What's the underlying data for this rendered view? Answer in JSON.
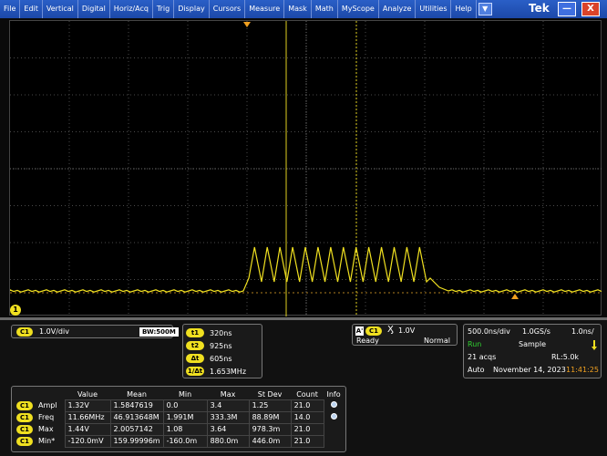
{
  "menu": {
    "items": [
      "File",
      "Edit",
      "Vertical",
      "Digital",
      "Horiz/Acq",
      "Trig",
      "Display",
      "Cursors",
      "Measure",
      "Mask",
      "Math",
      "MyScope",
      "Analyze",
      "Utilities",
      "Help"
    ],
    "dropdown_symbol": "▼",
    "brand": "Tek",
    "minimize_symbol": "—",
    "close_symbol": "X"
  },
  "scope": {
    "channel_marker": "1",
    "trace_color": "#f0e020",
    "pulse_count": 14
  },
  "channel": {
    "badge": "C1",
    "scale": "1.0V/div",
    "bandwidth": "BW:500M"
  },
  "cursors": [
    {
      "label": "t1",
      "value": "320ns"
    },
    {
      "label": "t2",
      "value": "925ns"
    },
    {
      "label": "Δt",
      "value": "605ns"
    },
    {
      "label": "1/Δt",
      "value": "1.653MHz"
    }
  ],
  "trigger": {
    "source_letter": "A'",
    "channel": "C1",
    "edge_symbol": "Ӽ",
    "level": "1.0V",
    "status": "Ready",
    "mode": "Normal"
  },
  "acquisition": {
    "timebase": "500.0ns/div",
    "sample_rate": "1.0GS/s",
    "resolution": "1.0ns/",
    "state": "Run",
    "acq_mode": "Sample",
    "acqs": "21 acqs",
    "record_length": "RL:5.0k",
    "trigger_mode": "Auto",
    "date": "November 14, 2023",
    "time": "11:41:25"
  },
  "measurements": {
    "headers": [
      "",
      "",
      "Value",
      "Mean",
      "Min",
      "Max",
      "St Dev",
      "Count",
      "Info"
    ],
    "rows": [
      {
        "channel": "C1",
        "name": "Ampl",
        "value": "1.32V",
        "mean": "1.5847619",
        "min": "0.0",
        "max": "3.4",
        "stdev": "1.25",
        "count": "21.0",
        "info": true
      },
      {
        "channel": "C1",
        "name": "Freq",
        "value": "11.66MHz",
        "mean": "46.913648M",
        "min": "1.991M",
        "max": "333.3M",
        "stdev": "88.89M",
        "count": "14.0",
        "info": true
      },
      {
        "channel": "C1",
        "name": "Max",
        "value": "1.44V",
        "mean": "2.0057142",
        "min": "1.08",
        "max": "3.64",
        "stdev": "978.3m",
        "count": "21.0",
        "info": false
      },
      {
        "channel": "C1",
        "name": "Min*",
        "value": "-120.0mV",
        "mean": "159.99996m",
        "min": "-160.0m",
        "max": "880.0m",
        "stdev": "446.0m",
        "count": "21.0",
        "info": false
      }
    ]
  }
}
